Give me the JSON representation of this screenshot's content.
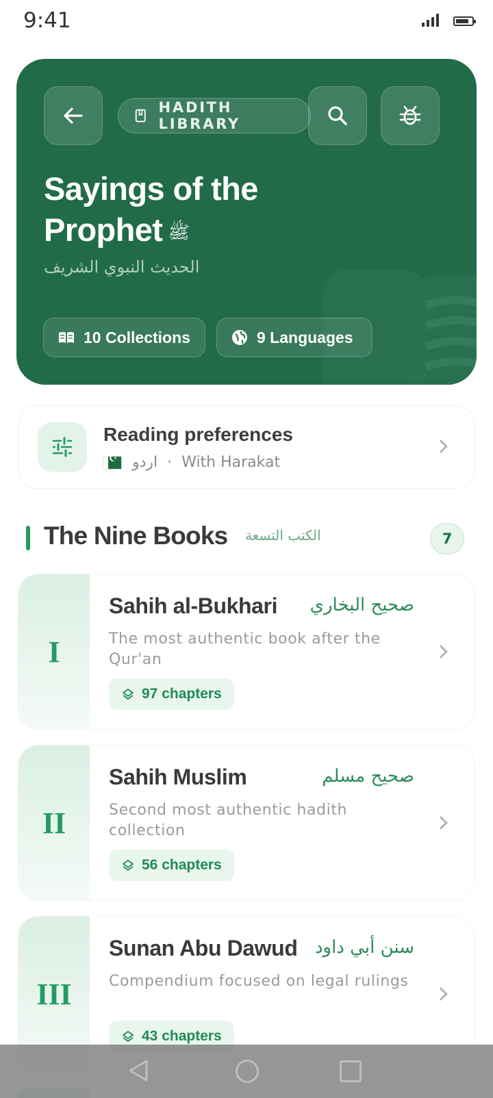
{
  "status_bar": {
    "time": "9:41"
  },
  "header": {
    "library_label": "HADITH LIBRARY",
    "title_line1": "Sayings of the",
    "title_line2": "Prophet",
    "honorific": "ﷺ",
    "arabic_subtitle": "الحديث النبوي الشريف",
    "collections_label": "10 Collections",
    "languages_label": "9 Languages"
  },
  "preferences": {
    "title": "Reading preferences",
    "language": "اردو",
    "separator": "·",
    "mode": "With Harakat"
  },
  "section": {
    "title": "The Nine Books",
    "arabic": "الكتب التسعة",
    "count": "7"
  },
  "books": [
    {
      "numeral": "I",
      "name": "Sahih al-Bukhari",
      "arabic": "صحيح البخاري",
      "description": "The most authentic book after the Qur'an",
      "chapters": "97 chapters"
    },
    {
      "numeral": "II",
      "name": "Sahih Muslim",
      "arabic": "صحيح مسلم",
      "description": "Second most authentic hadith collection",
      "chapters": "56 chapters"
    },
    {
      "numeral": "III",
      "name": "Sunan Abu Dawud",
      "arabic": "سنن أبي داود",
      "description": "Compendium focused on legal rulings",
      "chapters": "43 chapters"
    }
  ],
  "colors": {
    "brand_green": "#226b49",
    "accent_green": "#239b62",
    "chip_bg": "#e9f6ee"
  },
  "icons": {
    "back": "arrow-left-icon",
    "library": "book-icon",
    "search": "search-icon",
    "debug": "bug-icon",
    "collections": "open-book-icon",
    "languages": "globe-icon",
    "preferences": "sliders-icon",
    "chapters": "layers-icon"
  }
}
